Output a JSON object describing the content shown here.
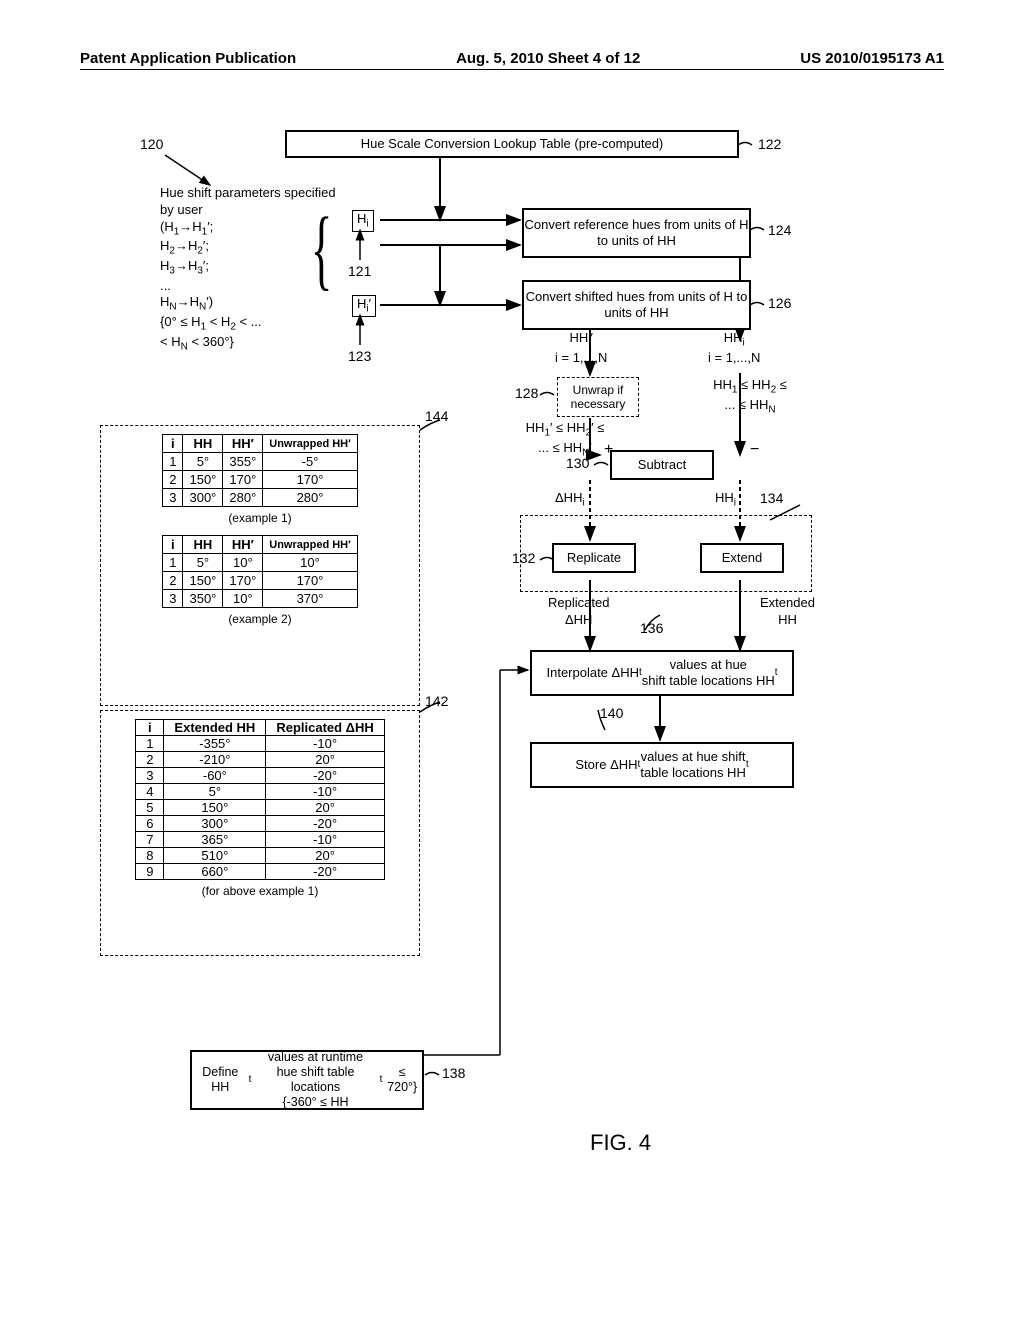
{
  "header": {
    "left": "Patent Application Publication",
    "center": "Aug. 5, 2010  Sheet 4 of 12",
    "right": "US 2010/0195173 A1"
  },
  "figure_label": "FIG. 4",
  "refs": {
    "r120": "120",
    "r121": "121",
    "r122": "122",
    "r123": "123",
    "r124": "124",
    "r126": "126",
    "r128": "128",
    "r130": "130",
    "r132": "132",
    "r134": "134",
    "r136": "136",
    "r138": "138",
    "r140": "140",
    "r142": "142",
    "r144": "144"
  },
  "boxes": {
    "lut": "Hue Scale Conversion Lookup Table (pre-computed)",
    "conv_ref": "Convert reference hues from units of H to units of HH",
    "conv_shift": "Convert shifted hues from units of H to units of HH",
    "unwrap": "Unwrap if necessary",
    "subtract": "Subtract",
    "replicate": "Replicate",
    "extend": "Extend",
    "interpolate": "Interpolate ΔHHₜ values at hue shift table locations HHₜ",
    "store": "Store ΔHHₜ values at hue shift table locations HHₜ",
    "define_hht": "Define HHₜ values at runtime hue shift table locations {-360° ≤ HHₜ ≤ 720°}"
  },
  "labels": {
    "params_title": "Hue shift parameters specified by user",
    "params_body": "(H₁→H₁′; H₂→H₂′; H₃→H₃′; ... Hₙ→Hₙ′)",
    "params_constraint": "{0° ≤ H₁ < H₂ < ... < Hₙ < 360°}",
    "hi": "Hᵢ",
    "hip": "Hᵢ′",
    "hhi_prime_n": "HHᵢ′  i = 1,...,N",
    "hhi_n": "HHᵢ  i = 1,...,N",
    "hh1p_chain": "HH₁′ ≤ HH₂′ ≤ ... ≤ HHₙ′",
    "hh1_chain": "HH₁ ≤ HH₂ ≤ ... ≤ HHₙ",
    "plus": "+",
    "minus": "−",
    "dhhi": "ΔHHᵢ",
    "hhi": "HHᵢ",
    "repl_dhh": "Replicated ΔHH",
    "ext_hh": "Extended HH",
    "table1_caption": "(example 1)",
    "table2_caption": "(example 2)",
    "table3_caption": "(for above example 1)"
  },
  "table1": {
    "headers": [
      "i",
      "HH",
      "HH′",
      "Unwrapped HH′"
    ],
    "rows": [
      [
        "1",
        "5°",
        "355°",
        "-5°"
      ],
      [
        "2",
        "150°",
        "170°",
        "170°"
      ],
      [
        "3",
        "300°",
        "280°",
        "280°"
      ]
    ]
  },
  "table2": {
    "headers": [
      "i",
      "HH",
      "HH′",
      "Unwrapped HH′"
    ],
    "rows": [
      [
        "1",
        "5°",
        "10°",
        "10°"
      ],
      [
        "2",
        "150°",
        "170°",
        "170°"
      ],
      [
        "3",
        "350°",
        "10°",
        "370°"
      ]
    ]
  },
  "table3": {
    "headers": [
      "i",
      "Extended HH",
      "Replicated ΔHH"
    ],
    "rows": [
      [
        "1",
        "-355°",
        "-10°"
      ],
      [
        "2",
        "-210°",
        "20°"
      ],
      [
        "3",
        "-60°",
        "-20°"
      ],
      [
        "4",
        "5°",
        "-10°"
      ],
      [
        "5",
        "150°",
        "20°"
      ],
      [
        "6",
        "300°",
        "-20°"
      ],
      [
        "7",
        "365°",
        "-10°"
      ],
      [
        "8",
        "510°",
        "20°"
      ],
      [
        "9",
        "660°",
        "-20°"
      ]
    ]
  }
}
